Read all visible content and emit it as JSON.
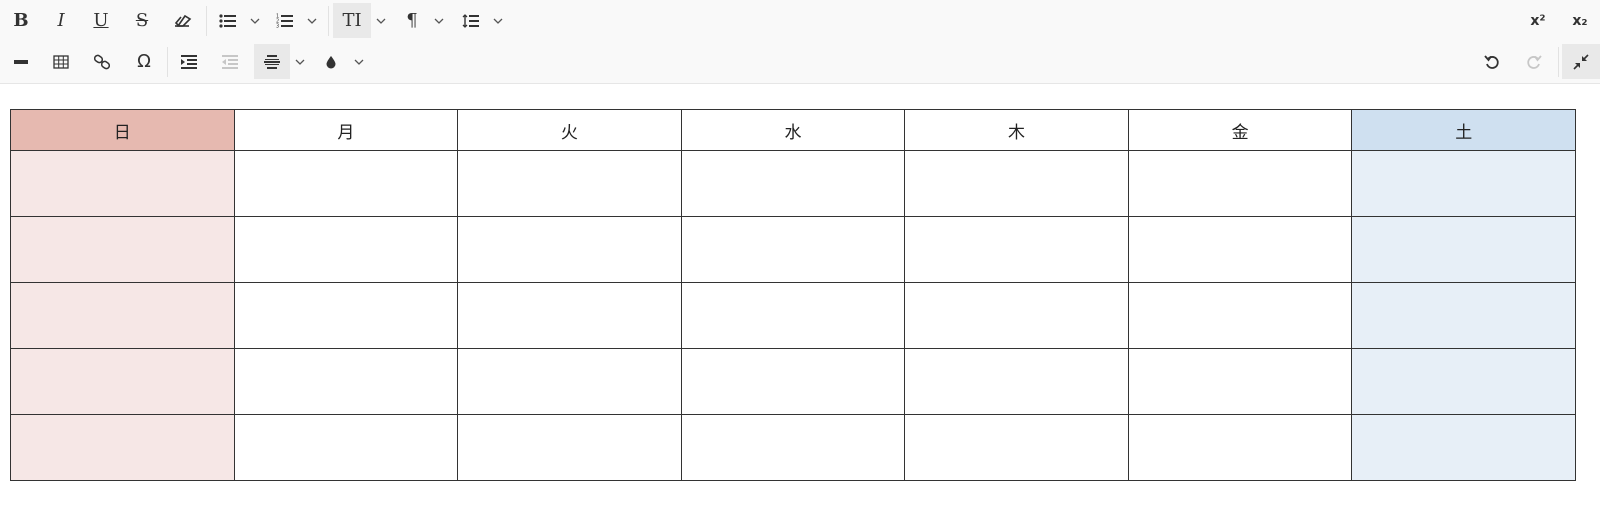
{
  "toolbar": {
    "row1_left": [
      {
        "name": "bold",
        "label": "B"
      },
      {
        "name": "italic",
        "label": "I"
      },
      {
        "name": "underline",
        "label": "U"
      },
      {
        "name": "strikethrough",
        "label": "S"
      },
      {
        "name": "remove-format",
        "label": ""
      },
      {
        "name": "bulleted-list",
        "label": ""
      },
      {
        "name": "numbered-list",
        "label": ""
      },
      {
        "name": "font-size",
        "label": "TI"
      },
      {
        "name": "paragraph",
        "label": "¶"
      },
      {
        "name": "line-height",
        "label": ""
      }
    ],
    "superscript_label": "x²",
    "subscript_label": "x₂",
    "row2_left": [
      {
        "name": "horizontal-line"
      },
      {
        "name": "insert-table"
      },
      {
        "name": "link"
      },
      {
        "name": "special-characters",
        "label": "Ω"
      },
      {
        "name": "indent"
      },
      {
        "name": "outdent",
        "state": "disabled"
      },
      {
        "name": "align-center",
        "state": "active"
      },
      {
        "name": "font-color"
      }
    ],
    "row2_right": [
      {
        "name": "undo"
      },
      {
        "name": "redo",
        "state": "disabled"
      },
      {
        "name": "minimize",
        "state": "active"
      }
    ],
    "colors": {
      "icon": "#333333",
      "disabled": "#c7c7c7",
      "active_bg": "#e9e9e9",
      "toolbar_bg": "#f9f9f9"
    }
  },
  "table": {
    "headers": [
      "日",
      "月",
      "火",
      "水",
      "木",
      "金",
      "土"
    ],
    "row_count": 5,
    "colors": {
      "sunday_header": "#e6b9b0",
      "sunday_cell": "#f6e7e6",
      "saturday_header": "#cfe0f0",
      "saturday_cell": "#e7eff7",
      "border": "#333333"
    }
  }
}
